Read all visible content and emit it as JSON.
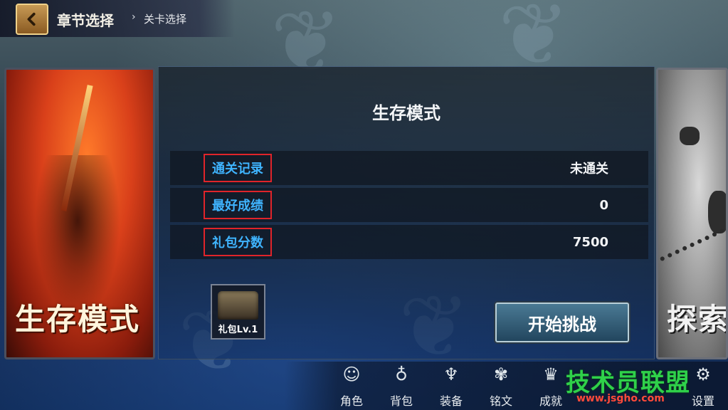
{
  "header": {
    "back_icon": "chevron-left-icon",
    "chapter_select": "章节选择",
    "separator": "›",
    "level_select": "关卡选择"
  },
  "left_card": {
    "title": "生存模式"
  },
  "right_card": {
    "title": "探索"
  },
  "panel": {
    "title": "生存模式",
    "stats": [
      {
        "label": "通关记录",
        "value": "未通关"
      },
      {
        "label": "最好成绩",
        "value": "0"
      },
      {
        "label": "礼包分数",
        "value": "7500"
      }
    ],
    "gift": {
      "label": "礼包Lv.1",
      "icon": "treasure-chest-icon"
    },
    "start_button": "开始挑战"
  },
  "bottom_nav": [
    {
      "label": "角色",
      "icon": "character-icon"
    },
    {
      "label": "背包",
      "icon": "bag-icon"
    },
    {
      "label": "装备",
      "icon": "armor-icon"
    },
    {
      "label": "铭文",
      "icon": "inscription-icon"
    },
    {
      "label": "成就",
      "icon": "trophy-icon"
    },
    {
      "label": "设置",
      "icon": "gear-icon"
    }
  ],
  "watermark": {
    "text": "技术员联盟",
    "url": "www.jsgho.com"
  },
  "colors": {
    "stat_label": "#3fb4ff",
    "highlight_box": "#e0242a",
    "start_button": "#22465e",
    "watermark": "#2fd14a"
  }
}
